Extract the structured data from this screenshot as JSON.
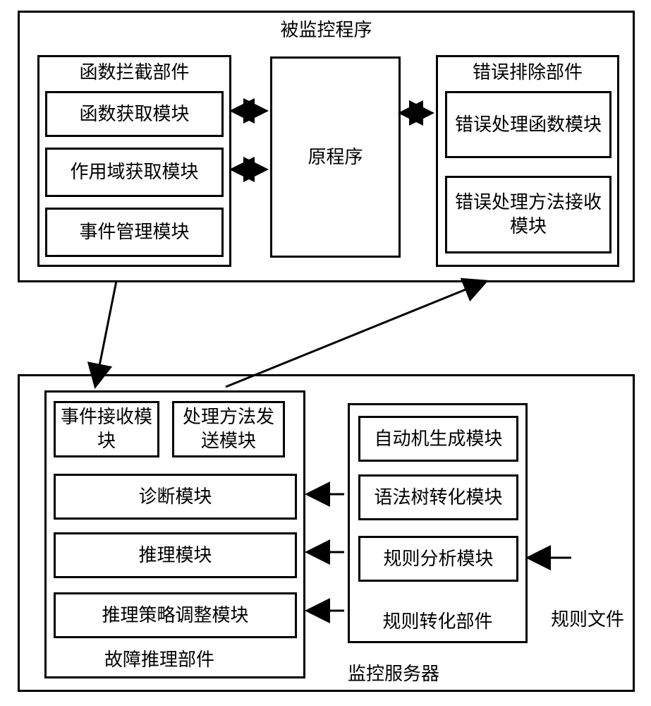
{
  "top": {
    "title": "被监控程序",
    "left": {
      "title": "函数拦截部件",
      "m1": "函数获取模块",
      "m2": "作用域获取模块",
      "m3": "事件管理模块"
    },
    "center": {
      "title": "原程序"
    },
    "right": {
      "title": "错误排除部件",
      "m1": "错误处理函数模块",
      "m2": "错误处理方法接收模块"
    }
  },
  "bottom": {
    "title": "监控服务器",
    "left": {
      "title": "故障推理部件",
      "m1": "事件接收模块",
      "m2": "处理方法发送模块",
      "m3": "诊断模块",
      "m4": "推理模块",
      "m5": "推理策略调整模块"
    },
    "right": {
      "title": "规则转化部件",
      "m1": "自动机生成模块",
      "m2": "语法树转化模块",
      "m3": "规则分析模块"
    },
    "rule_file": "规则文件"
  }
}
